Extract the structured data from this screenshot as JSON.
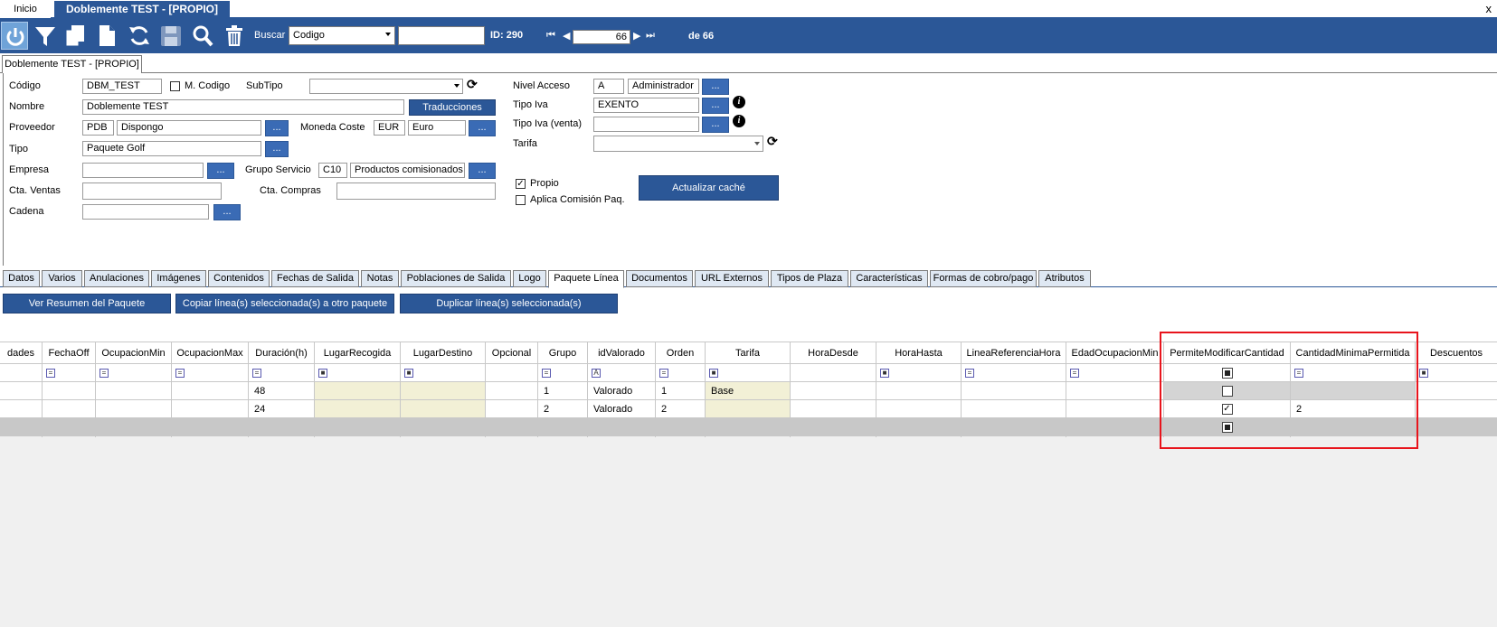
{
  "top_tabs": {
    "inicio": "Inicio",
    "document": "Doblemente TEST - [PROPIO]",
    "close": "x"
  },
  "toolbar": {
    "icons": [
      "power-icon",
      "filter-icon",
      "copy-icon",
      "new-document-icon",
      "refresh-icon",
      "save-icon",
      "search-icon",
      "trash-icon"
    ],
    "buscar_label": "Buscar",
    "search_field": "Codigo",
    "search_value": "",
    "id_label": "ID: 290",
    "record_current": "66",
    "record_total": "de 66"
  },
  "doc_tab": "Doblemente TEST - [PROPIO]",
  "form": {
    "codigo_label": "Código",
    "codigo_value": "DBM_TEST",
    "mcodigo_label": "M. Codigo",
    "subtipo_label": "SubTipo",
    "subtipo_value": "",
    "nombre_label": "Nombre",
    "nombre_value": "Doblemente TEST",
    "traducciones": "Traducciones",
    "proveedor_label": "Proveedor",
    "proveedor_code": "PDB",
    "proveedor_name": "Dispongo",
    "moneda_label": "Moneda Coste",
    "moneda_code": "EUR",
    "moneda_name": "Euro",
    "tipo_label": "Tipo",
    "tipo_value": "Paquete Golf",
    "empresa_label": "Empresa",
    "empresa_value": "",
    "grupo_label": "Grupo Servicio",
    "grupo_code": "C10",
    "grupo_name": "Productos comisionados",
    "ctaventas_label": "Cta. Ventas",
    "ctaventas_value": "",
    "ctacompras_label": "Cta. Compras",
    "ctacompras_value": "",
    "cadena_label": "Cadena",
    "cadena_value": "",
    "nivel_label": "Nivel Acceso",
    "nivel_code": "A",
    "nivel_name": "Administrador",
    "tipoiva_label": "Tipo Iva",
    "tipoiva_value": "EXENTO",
    "tipoivaventa_label": "Tipo Iva (venta)",
    "tipoivaventa_value": "",
    "tarifa_label": "Tarifa",
    "tarifa_value": "",
    "propio_label": "Propio",
    "propio_checked": true,
    "aplica_label": "Aplica Comisión Paq.",
    "aplica_checked": false,
    "actualizar": "Actualizar caché",
    "dots": "..."
  },
  "panel_tabs": [
    "Datos",
    "Varios",
    "Anulaciones",
    "Imágenes",
    "Contenidos",
    "Fechas de Salida",
    "Notas",
    "Poblaciones de Salida",
    "Logo",
    "Paquete Línea",
    "Documentos",
    "URL Externos",
    "Tipos de Plaza",
    "Características",
    "Formas de cobro/pago",
    "Atributos"
  ],
  "active_tab": "Paquete Línea",
  "actions": {
    "ver_resumen": "Ver Resumen del Paquete",
    "copiar": "Copiar línea(s) seleccionada(s) a otro paquete",
    "duplicar": "Duplicar línea(s) seleccionada(s)"
  },
  "grid": {
    "columns": [
      "dades",
      "FechaOff",
      "OcupacionMin",
      "OcupacionMax",
      "Duración(h)",
      "LugarRecogida",
      "LugarDestino",
      "Opcional",
      "Grupo",
      "idValorado",
      "Orden",
      "Tarifa",
      "HoraDesde",
      "HoraHasta",
      "LineaReferenciaHora",
      "EdadOcupacionMin",
      "PermiteModificarCantidad",
      "CantidadMinimaPermitida",
      "Descuentos"
    ],
    "rows": [
      {
        "duracion": "48",
        "grupo": "1",
        "valorado": "Valorado",
        "orden": "1",
        "tarifa": "Base",
        "permite": false,
        "cantidad": ""
      },
      {
        "duracion": "24",
        "grupo": "2",
        "valorado": "Valorado",
        "orden": "2",
        "tarifa": "",
        "permite": true,
        "cantidad": "2"
      }
    ],
    "filter_symbol": "="
  }
}
